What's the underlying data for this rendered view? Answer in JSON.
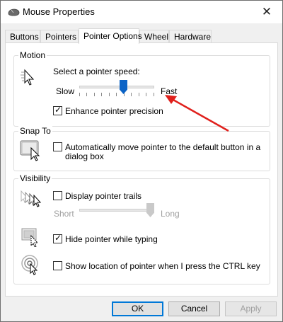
{
  "window": {
    "title": "Mouse Properties",
    "title_icon": "mouse-icon",
    "close_icon": "close-icon",
    "close_glyph": "✕"
  },
  "tabs": [
    {
      "label": "Buttons",
      "active": false
    },
    {
      "label": "Pointers",
      "active": false
    },
    {
      "label": "Pointer Options",
      "active": true
    },
    {
      "label": "Wheel",
      "active": false
    },
    {
      "label": "Hardware",
      "active": false
    }
  ],
  "motion": {
    "legend": "Motion",
    "speed_label": "Select a pointer speed:",
    "slow_label": "Slow",
    "fast_label": "Fast",
    "speed_value": 0.6,
    "enhance_label": "Enhance pointer precision",
    "enhance_checked": true
  },
  "snap_to": {
    "legend": "Snap To",
    "auto_move_label_line1": "Automatically move pointer to the default button in a",
    "auto_move_label_line2": "dialog box",
    "auto_move_checked": false
  },
  "visibility": {
    "legend": "Visibility",
    "trails_label": "Display pointer trails",
    "trails_checked": false,
    "short_label": "Short",
    "long_label": "Long",
    "trail_length_value": 1.0,
    "hide_typing_label": "Hide pointer while typing",
    "hide_typing_checked": true,
    "show_location_label": "Show location of pointer when I press the CTRL key",
    "show_location_checked": false
  },
  "buttons": {
    "ok": "OK",
    "cancel": "Cancel",
    "apply": "Apply"
  },
  "annotation": {
    "arrow_color": "#e0201c"
  },
  "colors": {
    "slider_thumb": "#0b63c6",
    "default_button_border": "#0078d7"
  },
  "check_glyph": "✓"
}
